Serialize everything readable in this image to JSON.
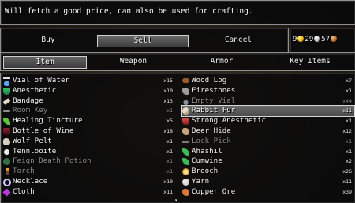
{
  "description": "Will fetch a good price, can also be used for crafting.",
  "commands": {
    "buy": "Buy",
    "sell": "Sell",
    "cancel": "Cancel"
  },
  "currency": {
    "gold": "9",
    "silver": "29",
    "copper": "57"
  },
  "categories": {
    "item": "Item",
    "weapon": "Weapon",
    "armor": "Armor",
    "key_items": "Key Items"
  },
  "items_left": [
    {
      "name": "Vial of Water",
      "qty": "x15",
      "icon": "vial-icon",
      "enabled": true
    },
    {
      "name": "Anesthetic",
      "qty": "x10",
      "icon": "potion-icon",
      "enabled": true
    },
    {
      "name": "Bandage",
      "qty": "x13",
      "icon": "bandage-icon",
      "enabled": true
    },
    {
      "name": "Room Key",
      "qty": "x1",
      "icon": "key-icon",
      "enabled": false
    },
    {
      "name": "Healing Tincture",
      "qty": "x5",
      "icon": "herb-icon",
      "enabled": true
    },
    {
      "name": "Bottle of Wine",
      "qty": "x18",
      "icon": "wine-icon",
      "enabled": true
    },
    {
      "name": "Wolf Pelt",
      "qty": "x1",
      "icon": "pelt-icon",
      "enabled": true
    },
    {
      "name": "Tennlooite",
      "qty": "x1",
      "icon": "gem-icon",
      "enabled": true
    },
    {
      "name": "Feign Death Potion",
      "qty": "x1",
      "icon": "potion-icon",
      "enabled": false
    },
    {
      "name": "Torch",
      "qty": "x1",
      "icon": "torch-icon",
      "enabled": false
    },
    {
      "name": "Necklace",
      "qty": "x10",
      "icon": "necklace-icon",
      "enabled": true
    },
    {
      "name": "Cloth",
      "qty": "x11",
      "icon": "cloth-icon",
      "enabled": true
    }
  ],
  "items_right": [
    {
      "name": "Wood Log",
      "qty": "x7",
      "icon": "log-icon",
      "enabled": true
    },
    {
      "name": "Firestones",
      "qty": "x1",
      "icon": "stone-icon",
      "enabled": true
    },
    {
      "name": "Empty Vial",
      "qty": "x44",
      "icon": "empty-vial-icon",
      "enabled": false
    },
    {
      "name": "Rabbit Fur",
      "qty": "x11",
      "icon": "fur-icon",
      "enabled": true,
      "selected": true
    },
    {
      "name": "Strong Anesthetic",
      "qty": "x1",
      "icon": "potion-icon",
      "enabled": true
    },
    {
      "name": "Deer Hide",
      "qty": "x12",
      "icon": "hide-icon",
      "enabled": true
    },
    {
      "name": "Lock Pick",
      "qty": "x1",
      "icon": "lockpick-icon",
      "enabled": false
    },
    {
      "name": "Ahashil",
      "qty": "x1",
      "icon": "herb-icon",
      "enabled": true
    },
    {
      "name": "Cumwine",
      "qty": "x2",
      "icon": "herb-icon",
      "enabled": true
    },
    {
      "name": "Brooch",
      "qty": "x26",
      "icon": "brooch-icon",
      "enabled": true
    },
    {
      "name": "Yarn",
      "qty": "x11",
      "icon": "yarn-icon",
      "enabled": true
    },
    {
      "name": "Copper Ore",
      "qty": "x39",
      "icon": "ore-icon",
      "enabled": true
    }
  ]
}
